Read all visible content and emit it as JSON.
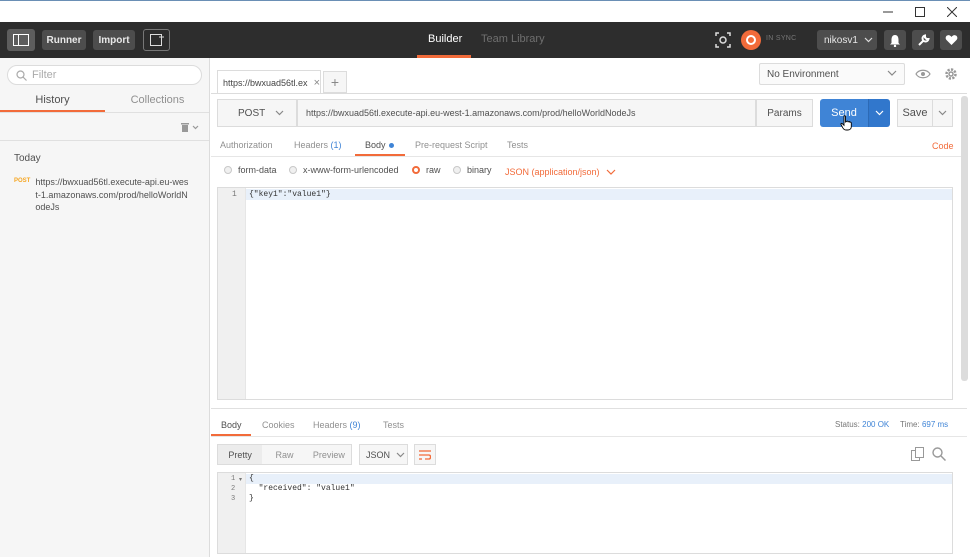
{
  "header": {
    "runner_label": "Runner",
    "import_label": "Import",
    "tabs": [
      {
        "label": "Builder"
      },
      {
        "label": "Team Library"
      }
    ],
    "sync_status": "IN SYNC",
    "user": "nikosv1"
  },
  "sidebar": {
    "filter_placeholder": "Filter",
    "tabs": [
      {
        "label": "History"
      },
      {
        "label": "Collections"
      }
    ],
    "group_label": "Today",
    "items": [
      {
        "method": "POST",
        "url": "https://bwxuad56tl.execute-api.eu-west-1.amazonaws.com/prod/helloWorldNodeJs"
      }
    ]
  },
  "request_tabs": [
    {
      "label": "https://bwxuad56tl.ex"
    }
  ],
  "environment": {
    "selected": "No Environment"
  },
  "request": {
    "method": "POST",
    "url": "https://bwxuad56tl.execute-api.eu-west-1.amazonaws.com/prod/helloWorldNodeJs",
    "params_label": "Params",
    "send_label": "Send",
    "save_label": "Save",
    "sections": {
      "authorization": "Authorization",
      "headers": "Headers",
      "headers_count": "(1)",
      "body": "Body",
      "prerequest": "Pre-request Script",
      "tests": "Tests"
    },
    "code_label": "Code",
    "body_types": [
      {
        "label": "form-data",
        "selected": false
      },
      {
        "label": "x-www-form-urlencoded",
        "selected": false
      },
      {
        "label": "raw",
        "selected": true
      },
      {
        "label": "binary",
        "selected": false
      }
    ],
    "content_type": "JSON (application/json)",
    "body_lines": [
      {
        "num": "1",
        "text": "{\"key1\":\"value1\"}"
      }
    ]
  },
  "response": {
    "tabs": {
      "body": "Body",
      "cookies": "Cookies",
      "headers": "Headers",
      "headers_count": "(9)",
      "tests": "Tests"
    },
    "status_label": "Status:",
    "status_value": "200 OK",
    "time_label": "Time:",
    "time_value": "697 ms",
    "views": [
      {
        "label": "Pretty"
      },
      {
        "label": "Raw"
      },
      {
        "label": "Preview"
      }
    ],
    "format": "JSON",
    "lines": [
      {
        "num": "1",
        "text": "{"
      },
      {
        "num": "2",
        "text": "  \"received\": \"value1\""
      },
      {
        "num": "3",
        "text": "}"
      }
    ]
  },
  "colors": {
    "accent": "#f26b3a",
    "primary": "#3f84d6",
    "header_bg": "#2d2d2d"
  },
  "icons": [
    "minimize-icon",
    "maximize-icon",
    "close-icon",
    "sidebar-toggle-icon",
    "new-window-icon",
    "interceptor-icon",
    "sync-icon",
    "bell-icon",
    "wrench-icon",
    "heart-icon",
    "search-icon",
    "trash-icon",
    "eye-icon",
    "gear-icon",
    "chevron-down-icon",
    "wrap-icon",
    "copy-icon"
  ]
}
